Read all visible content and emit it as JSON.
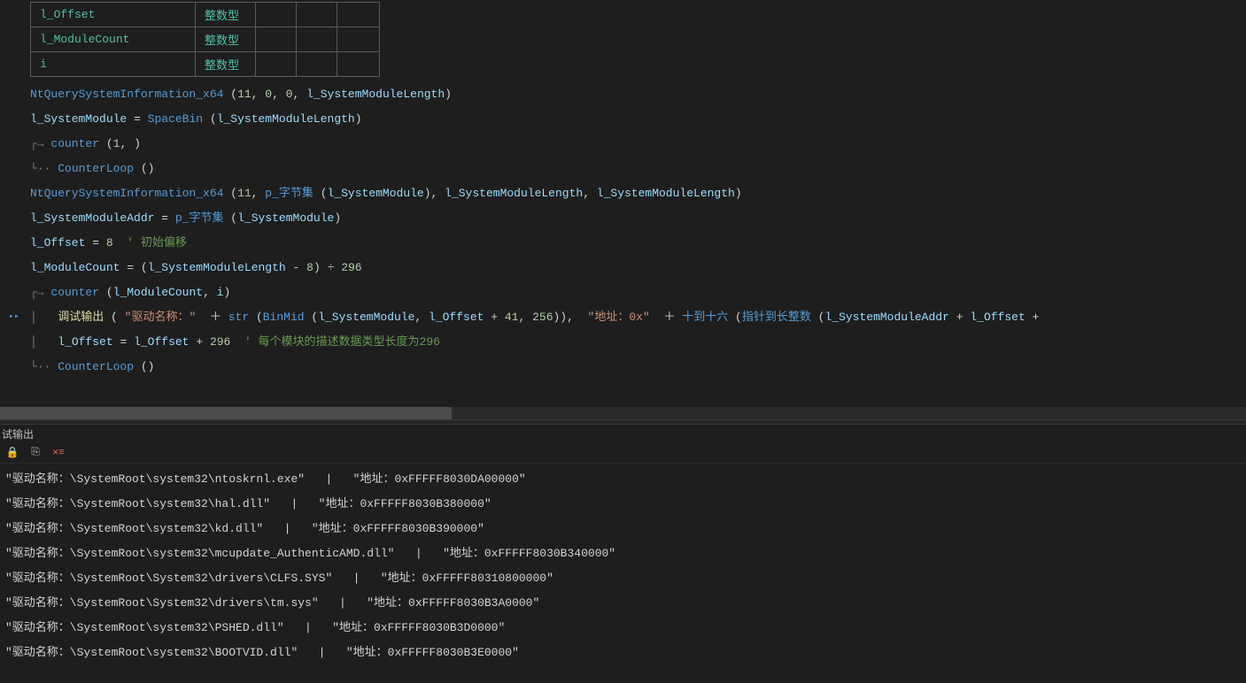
{
  "variables": [
    {
      "name": "l_Offset",
      "type": "整数型"
    },
    {
      "name": "l_ModuleCount",
      "type": "整数型"
    },
    {
      "name": "i",
      "type": "整数型"
    }
  ],
  "code": {
    "l1_fn": "NtQuerySystemInformation_x64",
    "l1_args_a": "11",
    "l1_args_b": "0",
    "l1_args_c": "0",
    "l1_args_d": "l_SystemModuleLength",
    "l2_lhs": "l_SystemModule",
    "l2_fn": "SpaceBin",
    "l2_arg": "l_SystemModuleLength",
    "l3_guide": "┌→ ",
    "l3_fn": "counter",
    "l3_arg": "1",
    "l4_guide": "└·· ",
    "l4_fn": "CounterLoop",
    "l5_fn": "NtQuerySystemInformation_x64",
    "l5_a": "11",
    "l5_b": "p_字节集",
    "l5_barg": "l_SystemModule",
    "l5_c": "l_SystemModuleLength",
    "l5_d": "l_SystemModuleLength",
    "l6_lhs": "l_SystemModuleAddr",
    "l6_fn": "p_字节集",
    "l6_arg": "l_SystemModule",
    "l7_lhs": "l_Offset",
    "l7_rhs": "8",
    "l7_comment": "' 初始偏移",
    "l8_lhs": "l_ModuleCount",
    "l8_a": "l_SystemModuleLength",
    "l8_b": "8",
    "l8_c": "296",
    "l9_guide": "┌→ ",
    "l9_fn": "counter",
    "l9_a": "l_ModuleCount",
    "l9_b": "i",
    "l10_guide": "│   ",
    "l10_fn": "调试输出",
    "l10_s1": "\"驱动名称：\"",
    "l10_strfn": "str",
    "l10_binmid": "BinMid",
    "l10_bm_a": "l_SystemModule",
    "l10_bm_b": "l_Offset",
    "l10_bm_c": "41",
    "l10_bm_d": "256",
    "l10_s2": "\"地址：0x\"",
    "l10_hexfn": "十到十六",
    "l10_ptrfn": "指针到长整数",
    "l10_pa": "l_SystemModuleAddr",
    "l10_pb": "l_Offset",
    "l11_guide": "│   ",
    "l11_lhs": "l_Offset",
    "l11_a": "l_Offset",
    "l11_b": "296",
    "l11_comment": "' 每个模块的描述数据类型长度为296",
    "l12_guide": "└·· ",
    "l12_fn": "CounterLoop"
  },
  "output": {
    "panel_title": "试输出",
    "label_drv": "\"驱动名称：",
    "label_addr": "\"地址：",
    "sep": "   |   ",
    "rows": [
      {
        "path": "\\SystemRoot\\system32\\ntoskrnl.exe\"",
        "addr": "0xFFFFF8030DA00000\""
      },
      {
        "path": "\\SystemRoot\\system32\\hal.dll\"",
        "addr": "0xFFFFF8030B380000\""
      },
      {
        "path": "\\SystemRoot\\system32\\kd.dll\"",
        "addr": "0xFFFFF8030B390000\""
      },
      {
        "path": "\\SystemRoot\\system32\\mcupdate_AuthenticAMD.dll\"",
        "addr": "0xFFFFF8030B340000\""
      },
      {
        "path": "\\SystemRoot\\System32\\drivers\\CLFS.SYS\"",
        "addr": "0xFFFFF80310800000\""
      },
      {
        "path": "\\SystemRoot\\System32\\drivers\\tm.sys\"",
        "addr": "0xFFFFF8030B3A0000\""
      },
      {
        "path": "\\SystemRoot\\system32\\PSHED.dll\"",
        "addr": "0xFFFFF8030B3D0000\""
      },
      {
        "path": "\\SystemRoot\\system32\\BOOTVID.dll\"",
        "addr": "0xFFFFF8030B3E0000\""
      }
    ]
  },
  "toolbar": {
    "lock_icon": "🔒",
    "copy_icon": "⎘",
    "clear_icon": "✕≡"
  }
}
